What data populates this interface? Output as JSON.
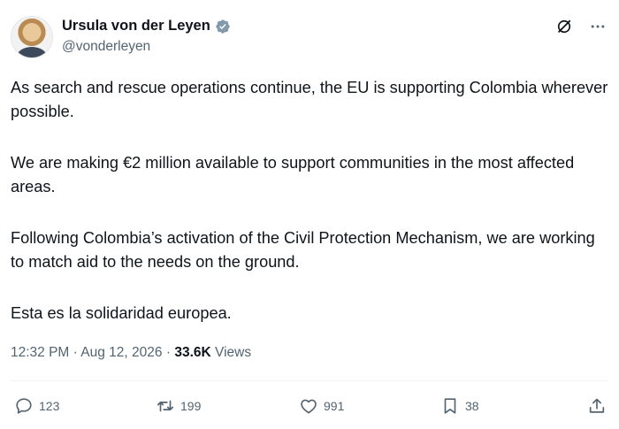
{
  "author": {
    "display_name": "Ursula von der Leyen",
    "handle": "@vonderleyen",
    "avatar_icon": "profile-photo",
    "verified_icon": "verified-badge-icon"
  },
  "tweet": {
    "paragraphs": [
      "As search and rescue operations continue, the EU is supporting Colombia wherever possible.",
      "We are making €2 million available to support communities in the most affected areas.",
      "Following Colombia’s activation of the Civil Protection Mechanism, we are working to match aid to the needs on the ground.",
      "Esta es la solidaridad europea."
    ],
    "time": "12:32 PM",
    "separator": "·",
    "date": "Aug 12, 2026",
    "views_count": "33.6K",
    "views_label": "Views"
  },
  "actions": {
    "replies": "123",
    "reposts": "199",
    "likes": "991",
    "bookmarks": "38"
  },
  "colors": {
    "text": "#0f1419",
    "secondary": "#536471",
    "verified": "#829aab",
    "divider": "#eff3f4"
  }
}
